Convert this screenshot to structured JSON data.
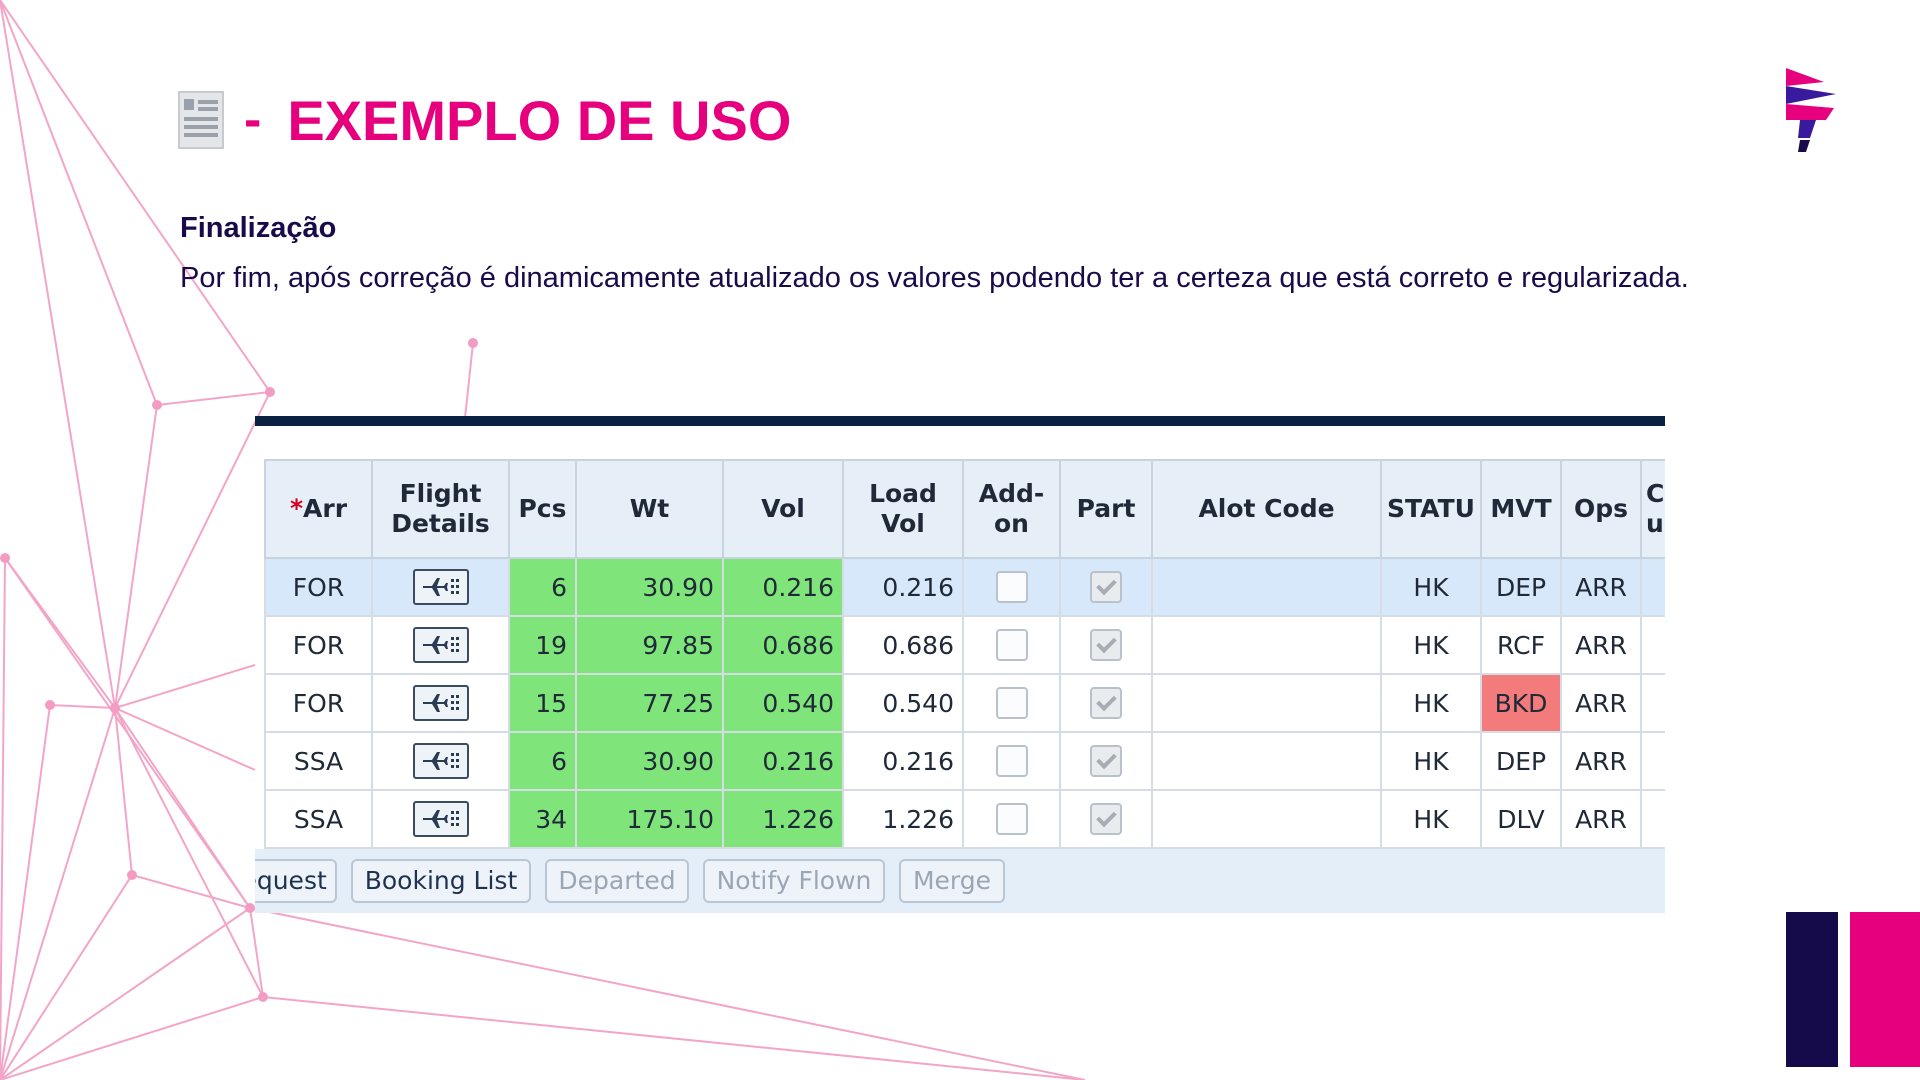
{
  "slide": {
    "title_dash": "-",
    "title": "EXEMPLO DE USO",
    "subtitle": "Finalização",
    "paragraph": "Por fim, após correção é dinamicamente atualizado os valores podendo ter a certeza que está correto e regularizada."
  },
  "icons": {
    "title_icon": "document-icon",
    "logo": "latam-logo",
    "flight_details": "airplane-icon"
  },
  "colors": {
    "accent_pink": "#e6007e",
    "navy": "#1b0a4a",
    "table_green": "#7fe57a",
    "bkd_red": "#f47b7b"
  },
  "table": {
    "columns": {
      "arr_asterisk": "*",
      "arr": "Arr",
      "flight_details": "Flight Details",
      "pcs": "Pcs",
      "wt": "Wt",
      "vol": "Vol",
      "load_vol": "Load Vol",
      "addon": "Add-on",
      "part": "Part",
      "alot_code": "Alot Code",
      "status": "STATU",
      "mvt": "MVT",
      "ops": "Ops",
      "clipped": "C A u"
    },
    "rows": [
      {
        "arr": "FOR",
        "pcs": "6",
        "wt": "30.90",
        "vol": "0.216",
        "load_vol": "0.216",
        "addon": false,
        "part": true,
        "alot_code": "",
        "status": "HK",
        "mvt": "DEP",
        "ops": "ARR",
        "selected": true
      },
      {
        "arr": "FOR",
        "pcs": "19",
        "wt": "97.85",
        "vol": "0.686",
        "load_vol": "0.686",
        "addon": false,
        "part": true,
        "alot_code": "",
        "status": "HK",
        "mvt": "RCF",
        "ops": "ARR",
        "selected": false
      },
      {
        "arr": "FOR",
        "pcs": "15",
        "wt": "77.25",
        "vol": "0.540",
        "load_vol": "0.540",
        "addon": false,
        "part": true,
        "alot_code": "",
        "status": "HK",
        "mvt": "BKD",
        "ops": "ARR",
        "selected": false
      },
      {
        "arr": "SSA",
        "pcs": "6",
        "wt": "30.90",
        "vol": "0.216",
        "load_vol": "0.216",
        "addon": false,
        "part": true,
        "alot_code": "",
        "status": "HK",
        "mvt": "DEP",
        "ops": "ARR",
        "selected": false
      },
      {
        "arr": "SSA",
        "pcs": "34",
        "wt": "175.10",
        "vol": "1.226",
        "load_vol": "1.226",
        "addon": false,
        "part": true,
        "alot_code": "",
        "status": "HK",
        "mvt": "DLV",
        "ops": "ARR",
        "selected": false
      }
    ]
  },
  "buttons": {
    "request": "Request",
    "booking_list": "Booking List",
    "departed": "Departed",
    "notify_flown": "Notify Flown",
    "merge": "Merge"
  }
}
